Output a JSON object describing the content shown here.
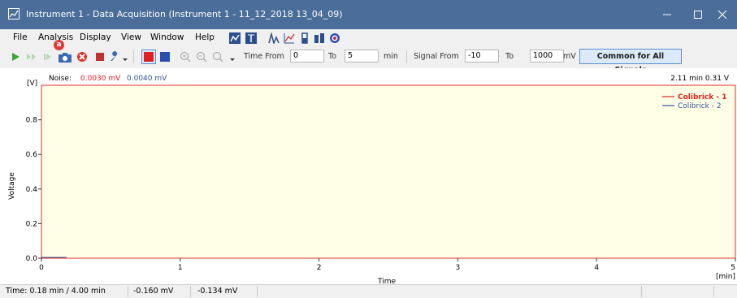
{
  "window": {
    "title": "Instrument 1 - Data Acquisition (Instrument 1 - 11_12_2018 13_04_09)",
    "minimize_icon": "minimize-icon",
    "maximize_icon": "maximize-icon",
    "close_icon": "close-icon"
  },
  "menu": {
    "items": [
      "File",
      "Analysis",
      "Display",
      "View",
      "Window",
      "Help"
    ]
  },
  "toolbar": {
    "time_from_label": "Time From",
    "time_from_value": "0",
    "time_to_label": "To",
    "time_to_value": "5",
    "time_unit": "min",
    "signal_from_label": "Signal From",
    "signal_from_value": "-10",
    "signal_to_label": "To",
    "signal_to_value": "1000",
    "signal_unit": "mV",
    "common_button": "Common for All Signals",
    "badge": "a"
  },
  "chart_header": {
    "noise_label": "Noise:",
    "noise_1": "0.0030 mV",
    "noise_2": "0.0040 mV",
    "cursor_readout": "2.11 min  0.31 V"
  },
  "chart_data": {
    "type": "line",
    "ylabel": "Voltage",
    "xlabel": "Time",
    "y_unit": "[V]",
    "x_unit": "[min]",
    "xlim": [
      0,
      5
    ],
    "ylim": [
      0,
      1
    ],
    "x_ticks": [
      "0",
      "1",
      "2",
      "3",
      "4",
      "5"
    ],
    "y_ticks": [
      "0.0",
      "0.2",
      "0.4",
      "0.6",
      "0.8"
    ],
    "y_tick_values": [
      0.0,
      0.2,
      0.4,
      0.6,
      0.8
    ],
    "x_tick_values": [
      0,
      1,
      2,
      3,
      4,
      5
    ],
    "background": "#ffffe6",
    "frame_color": "#e03030",
    "series": [
      {
        "name": "Colibrick - 1",
        "color": "#e02020",
        "x": [
          0,
          0.18
        ],
        "y": [
          0.0,
          0.0
        ]
      },
      {
        "name": "Colibrick - 2",
        "color": "#3050a0",
        "x": [
          0,
          0.18
        ],
        "y": [
          0.0,
          0.0
        ]
      }
    ]
  },
  "status": {
    "time": "Time: 0.18 min / 4.00 min",
    "value_1": "-0.160 mV",
    "value_2": "-0.134 mV"
  }
}
